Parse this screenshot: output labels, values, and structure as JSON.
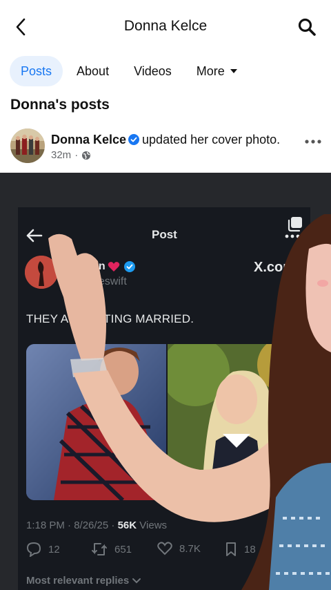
{
  "header": {
    "title": "Donna Kelce"
  },
  "tabs": [
    {
      "label": "Posts"
    },
    {
      "label": "About"
    },
    {
      "label": "Videos"
    },
    {
      "label": "More"
    }
  ],
  "section_title": "Donna's posts",
  "post": {
    "author": "Donna Kelce",
    "action": "updated her cover photo.",
    "time": "32m",
    "privacy": "·"
  },
  "embedded_tweet": {
    "screen_title": "Post",
    "name_visible": "rdan",
    "handle_visible": "ytaleswift",
    "watermark": "X.com",
    "text": "THEY A      ETTING MARRIED.",
    "timestamp": "1:18 PM · 8/26/25 ·",
    "views_count": "56K",
    "views_label": "Views",
    "replies": "12",
    "reposts": "651",
    "likes": "8.7K",
    "bookmarks": "18",
    "replies_sort": "Most relevant replies"
  },
  "colors": {
    "facebook_blue": "#1877f2",
    "tab_active_bg": "#e8f1fd",
    "x_dark_bg": "#16191f",
    "x_text": "#e7e9ea",
    "x_muted": "#71767b"
  }
}
